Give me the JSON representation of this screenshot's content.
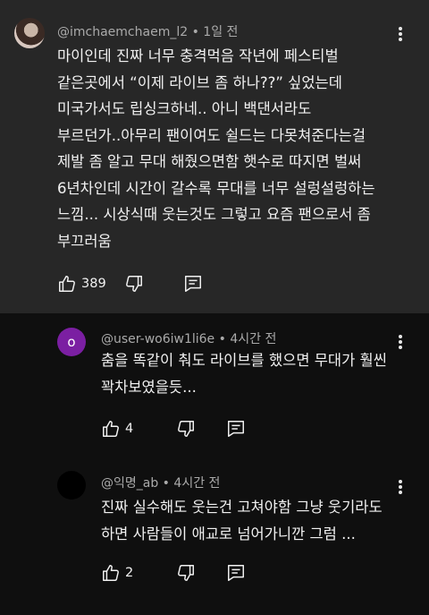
{
  "comments": [
    {
      "author": "@imchaemchaem_l2",
      "time": "1일 전",
      "text": "마이인데 진짜 너무 충격먹음 작년에 페스티벌\n같은곳에서 “이제 라이브 좀 하나??” 싶었는데\n미국가서도 립싱크하네.. 아니 백댄서라도\n부르던가..아무리 팬이여도 쉴드는 다못쳐준다는걸\n제발 좀 알고 무대 해줬으면함  햇수로 따지면 벌써\n6년차인데 시간이 갈수록 무대를 너무 설렁설렁하는\n느낌... 시상식때 웃는것도 그렇고 요즘 팬으로서 좀\n부끄러움",
      "likes": "389"
    },
    {
      "author": "@user-wo6iw1li6e",
      "time": "4시간 전",
      "avatar_letter": "o",
      "text": "춤을 똑같이 춰도 라이브를 했으면 무대가 훨씬\n꽉차보였을듯...",
      "likes": "4"
    },
    {
      "author": "@익명_ab",
      "time": "4시간 전",
      "text": "진짜 실수해도 웃는건 고쳐야함 그냥 웃기라도\n하면 사람들이 애교로 넘어가니깐 그럼 ...",
      "likes": "2"
    }
  ],
  "separator": " • ",
  "icons": {
    "like": "thumbs-up-icon",
    "dislike": "thumbs-down-icon",
    "reply": "reply-icon",
    "more": "more-vertical-icon"
  },
  "colors": {
    "background": "#0f0f0f",
    "highlight": "#272727",
    "text": "#f1f1f1",
    "meta": "#aaaaaa",
    "avatar_purple": "#7b1fa2"
  }
}
